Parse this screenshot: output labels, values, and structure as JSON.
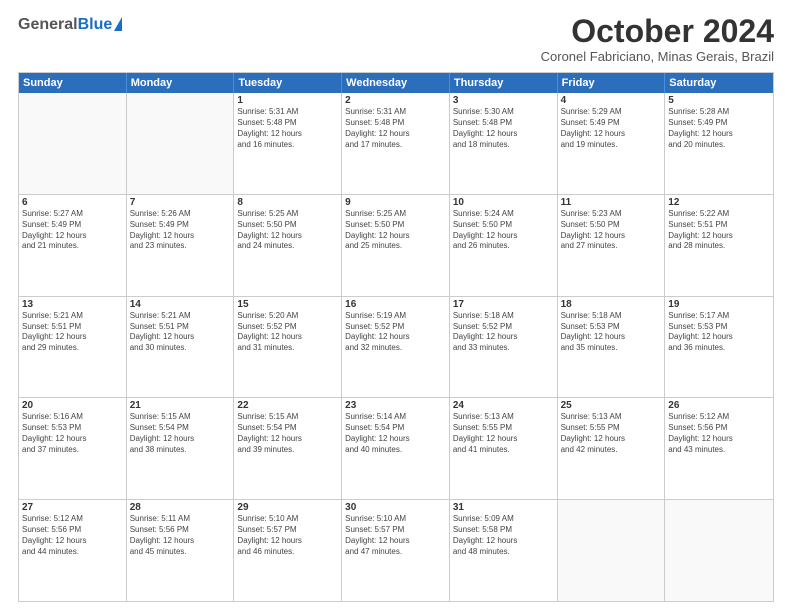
{
  "logo": {
    "general": "General",
    "blue": "Blue"
  },
  "header": {
    "month": "October 2024",
    "location": "Coronel Fabriciano, Minas Gerais, Brazil"
  },
  "weekdays": [
    "Sunday",
    "Monday",
    "Tuesday",
    "Wednesday",
    "Thursday",
    "Friday",
    "Saturday"
  ],
  "weeks": [
    [
      {
        "day": "",
        "lines": []
      },
      {
        "day": "",
        "lines": []
      },
      {
        "day": "1",
        "lines": [
          "Sunrise: 5:31 AM",
          "Sunset: 5:48 PM",
          "Daylight: 12 hours",
          "and 16 minutes."
        ]
      },
      {
        "day": "2",
        "lines": [
          "Sunrise: 5:31 AM",
          "Sunset: 5:48 PM",
          "Daylight: 12 hours",
          "and 17 minutes."
        ]
      },
      {
        "day": "3",
        "lines": [
          "Sunrise: 5:30 AM",
          "Sunset: 5:48 PM",
          "Daylight: 12 hours",
          "and 18 minutes."
        ]
      },
      {
        "day": "4",
        "lines": [
          "Sunrise: 5:29 AM",
          "Sunset: 5:49 PM",
          "Daylight: 12 hours",
          "and 19 minutes."
        ]
      },
      {
        "day": "5",
        "lines": [
          "Sunrise: 5:28 AM",
          "Sunset: 5:49 PM",
          "Daylight: 12 hours",
          "and 20 minutes."
        ]
      }
    ],
    [
      {
        "day": "6",
        "lines": [
          "Sunrise: 5:27 AM",
          "Sunset: 5:49 PM",
          "Daylight: 12 hours",
          "and 21 minutes."
        ]
      },
      {
        "day": "7",
        "lines": [
          "Sunrise: 5:26 AM",
          "Sunset: 5:49 PM",
          "Daylight: 12 hours",
          "and 23 minutes."
        ]
      },
      {
        "day": "8",
        "lines": [
          "Sunrise: 5:25 AM",
          "Sunset: 5:50 PM",
          "Daylight: 12 hours",
          "and 24 minutes."
        ]
      },
      {
        "day": "9",
        "lines": [
          "Sunrise: 5:25 AM",
          "Sunset: 5:50 PM",
          "Daylight: 12 hours",
          "and 25 minutes."
        ]
      },
      {
        "day": "10",
        "lines": [
          "Sunrise: 5:24 AM",
          "Sunset: 5:50 PM",
          "Daylight: 12 hours",
          "and 26 minutes."
        ]
      },
      {
        "day": "11",
        "lines": [
          "Sunrise: 5:23 AM",
          "Sunset: 5:50 PM",
          "Daylight: 12 hours",
          "and 27 minutes."
        ]
      },
      {
        "day": "12",
        "lines": [
          "Sunrise: 5:22 AM",
          "Sunset: 5:51 PM",
          "Daylight: 12 hours",
          "and 28 minutes."
        ]
      }
    ],
    [
      {
        "day": "13",
        "lines": [
          "Sunrise: 5:21 AM",
          "Sunset: 5:51 PM",
          "Daylight: 12 hours",
          "and 29 minutes."
        ]
      },
      {
        "day": "14",
        "lines": [
          "Sunrise: 5:21 AM",
          "Sunset: 5:51 PM",
          "Daylight: 12 hours",
          "and 30 minutes."
        ]
      },
      {
        "day": "15",
        "lines": [
          "Sunrise: 5:20 AM",
          "Sunset: 5:52 PM",
          "Daylight: 12 hours",
          "and 31 minutes."
        ]
      },
      {
        "day": "16",
        "lines": [
          "Sunrise: 5:19 AM",
          "Sunset: 5:52 PM",
          "Daylight: 12 hours",
          "and 32 minutes."
        ]
      },
      {
        "day": "17",
        "lines": [
          "Sunrise: 5:18 AM",
          "Sunset: 5:52 PM",
          "Daylight: 12 hours",
          "and 33 minutes."
        ]
      },
      {
        "day": "18",
        "lines": [
          "Sunrise: 5:18 AM",
          "Sunset: 5:53 PM",
          "Daylight: 12 hours",
          "and 35 minutes."
        ]
      },
      {
        "day": "19",
        "lines": [
          "Sunrise: 5:17 AM",
          "Sunset: 5:53 PM",
          "Daylight: 12 hours",
          "and 36 minutes."
        ]
      }
    ],
    [
      {
        "day": "20",
        "lines": [
          "Sunrise: 5:16 AM",
          "Sunset: 5:53 PM",
          "Daylight: 12 hours",
          "and 37 minutes."
        ]
      },
      {
        "day": "21",
        "lines": [
          "Sunrise: 5:15 AM",
          "Sunset: 5:54 PM",
          "Daylight: 12 hours",
          "and 38 minutes."
        ]
      },
      {
        "day": "22",
        "lines": [
          "Sunrise: 5:15 AM",
          "Sunset: 5:54 PM",
          "Daylight: 12 hours",
          "and 39 minutes."
        ]
      },
      {
        "day": "23",
        "lines": [
          "Sunrise: 5:14 AM",
          "Sunset: 5:54 PM",
          "Daylight: 12 hours",
          "and 40 minutes."
        ]
      },
      {
        "day": "24",
        "lines": [
          "Sunrise: 5:13 AM",
          "Sunset: 5:55 PM",
          "Daylight: 12 hours",
          "and 41 minutes."
        ]
      },
      {
        "day": "25",
        "lines": [
          "Sunrise: 5:13 AM",
          "Sunset: 5:55 PM",
          "Daylight: 12 hours",
          "and 42 minutes."
        ]
      },
      {
        "day": "26",
        "lines": [
          "Sunrise: 5:12 AM",
          "Sunset: 5:56 PM",
          "Daylight: 12 hours",
          "and 43 minutes."
        ]
      }
    ],
    [
      {
        "day": "27",
        "lines": [
          "Sunrise: 5:12 AM",
          "Sunset: 5:56 PM",
          "Daylight: 12 hours",
          "and 44 minutes."
        ]
      },
      {
        "day": "28",
        "lines": [
          "Sunrise: 5:11 AM",
          "Sunset: 5:56 PM",
          "Daylight: 12 hours",
          "and 45 minutes."
        ]
      },
      {
        "day": "29",
        "lines": [
          "Sunrise: 5:10 AM",
          "Sunset: 5:57 PM",
          "Daylight: 12 hours",
          "and 46 minutes."
        ]
      },
      {
        "day": "30",
        "lines": [
          "Sunrise: 5:10 AM",
          "Sunset: 5:57 PM",
          "Daylight: 12 hours",
          "and 47 minutes."
        ]
      },
      {
        "day": "31",
        "lines": [
          "Sunrise: 5:09 AM",
          "Sunset: 5:58 PM",
          "Daylight: 12 hours",
          "and 48 minutes."
        ]
      },
      {
        "day": "",
        "lines": []
      },
      {
        "day": "",
        "lines": []
      }
    ]
  ]
}
